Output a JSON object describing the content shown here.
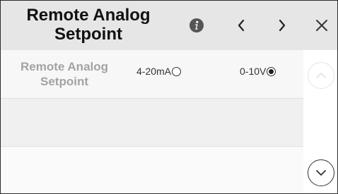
{
  "header": {
    "title_line1": "Remote Analog",
    "title_line2": "Setpoint",
    "info_icon": "info-icon",
    "prev_icon": "chevron-left-icon",
    "next_icon": "chevron-right-icon",
    "close_icon": "close-icon"
  },
  "settings": {
    "rows": [
      {
        "label_line1": "Remote Analog",
        "label_line2": "Setpoint",
        "options": [
          {
            "label": "4-20mA",
            "selected": false
          },
          {
            "label": "0-10V",
            "selected": true
          }
        ]
      }
    ]
  },
  "scroll": {
    "up_icon": "chevron-up-icon",
    "down_icon": "chevron-down-icon",
    "up_enabled": false,
    "down_enabled": true
  },
  "colors": {
    "header_bg": "#e6e6e6",
    "label_disabled": "#a3a3a3",
    "text_dark": "#111111"
  }
}
